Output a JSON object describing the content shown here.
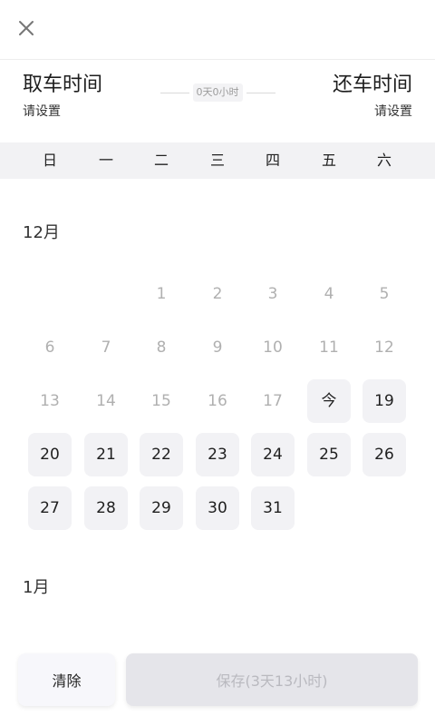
{
  "header": {
    "close_icon": "close-icon"
  },
  "pickup": {
    "title": "取车时间",
    "value": "请设置"
  },
  "return": {
    "title": "还车时间",
    "value": "请设置"
  },
  "duration": {
    "label": "0天0小时"
  },
  "weekdays": [
    "日",
    "一",
    "二",
    "三",
    "四",
    "五",
    "六"
  ],
  "months": [
    {
      "label": "12月",
      "weeks": [
        [
          null,
          null,
          {
            "text": "1",
            "state": "past"
          },
          {
            "text": "2",
            "state": "past"
          },
          {
            "text": "3",
            "state": "past"
          },
          {
            "text": "4",
            "state": "past"
          },
          {
            "text": "5",
            "state": "past"
          }
        ],
        [
          {
            "text": "6",
            "state": "past"
          },
          {
            "text": "7",
            "state": "past"
          },
          {
            "text": "8",
            "state": "past"
          },
          {
            "text": "9",
            "state": "past"
          },
          {
            "text": "10",
            "state": "past"
          },
          {
            "text": "11",
            "state": "past"
          },
          {
            "text": "12",
            "state": "past"
          }
        ],
        [
          {
            "text": "13",
            "state": "past"
          },
          {
            "text": "14",
            "state": "past"
          },
          {
            "text": "15",
            "state": "past"
          },
          {
            "text": "16",
            "state": "past"
          },
          {
            "text": "17",
            "state": "past"
          },
          {
            "text": "今",
            "state": "avail"
          },
          {
            "text": "19",
            "state": "avail"
          }
        ],
        [
          {
            "text": "20",
            "state": "avail"
          },
          {
            "text": "21",
            "state": "avail"
          },
          {
            "text": "22",
            "state": "avail"
          },
          {
            "text": "23",
            "state": "avail"
          },
          {
            "text": "24",
            "state": "avail"
          },
          {
            "text": "25",
            "state": "avail"
          },
          {
            "text": "26",
            "state": "avail"
          }
        ],
        [
          {
            "text": "27",
            "state": "avail"
          },
          {
            "text": "28",
            "state": "avail"
          },
          {
            "text": "29",
            "state": "avail"
          },
          {
            "text": "30",
            "state": "avail"
          },
          {
            "text": "31",
            "state": "avail"
          },
          null,
          null
        ]
      ]
    },
    {
      "label": "1月",
      "weeks": []
    }
  ],
  "footer": {
    "clear_label": "清除",
    "save_label": "保存(3天13小时)"
  },
  "colors": {
    "available_bg": "#f2f2f5",
    "past_text": "#b0b0b0",
    "save_disabled_bg": "#e5e5ea"
  }
}
